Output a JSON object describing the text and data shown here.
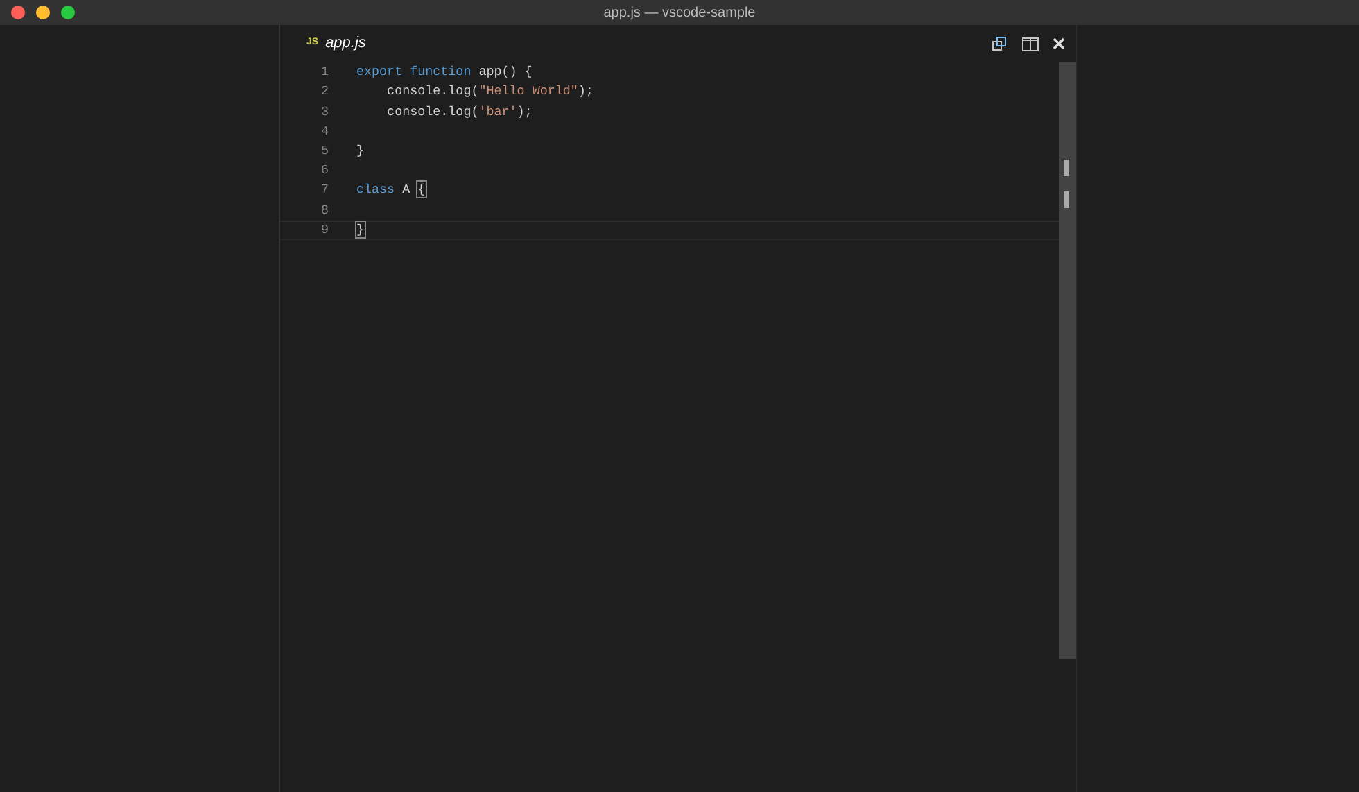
{
  "window": {
    "title": "app.js — vscode-sample"
  },
  "tab": {
    "badge": "JS",
    "label": "app.js"
  },
  "editor": {
    "lines": [
      {
        "number": "1",
        "current": false,
        "tokens": [
          {
            "kind": "keyword",
            "text": "export function"
          },
          {
            "kind": "plain",
            "text": " app() {"
          }
        ]
      },
      {
        "number": "2",
        "current": false,
        "tokens": [
          {
            "kind": "plain",
            "text": "    console.log("
          },
          {
            "kind": "string",
            "text": "\"Hello World\""
          },
          {
            "kind": "plain",
            "text": ");"
          }
        ]
      },
      {
        "number": "3",
        "current": false,
        "tokens": [
          {
            "kind": "plain",
            "text": "    console.log("
          },
          {
            "kind": "string",
            "text": "'bar'"
          },
          {
            "kind": "plain",
            "text": ");"
          }
        ]
      },
      {
        "number": "4",
        "current": false
      },
      {
        "number": "5",
        "current": false,
        "tokens": [
          {
            "kind": "plain",
            "text": "}"
          }
        ]
      },
      {
        "number": "6",
        "current": false
      },
      {
        "number": "7",
        "current": false,
        "tokens": [
          {
            "kind": "keyword",
            "text": "class"
          },
          {
            "kind": "plain",
            "text": " A "
          },
          {
            "kind": "bracket",
            "text": "{"
          }
        ]
      },
      {
        "number": "8",
        "current": false
      },
      {
        "number": "9",
        "current": true,
        "tokens": [
          {
            "kind": "bracket",
            "text": "}"
          }
        ]
      }
    ]
  }
}
